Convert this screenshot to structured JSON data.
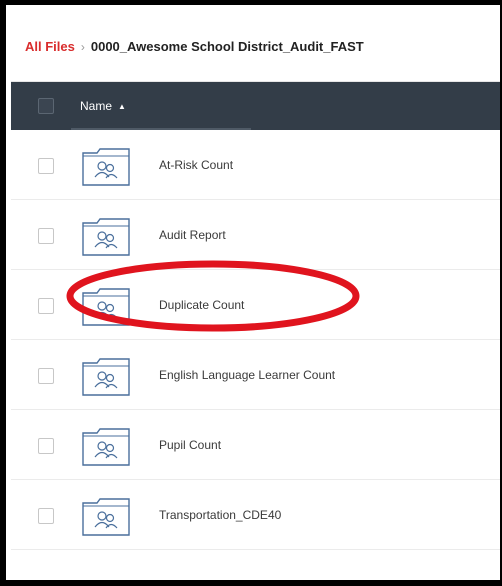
{
  "breadcrumb": {
    "root": "All Files",
    "separator": "›",
    "current": "0000_Awesome School District_Audit_FAST"
  },
  "table": {
    "header": {
      "name_label": "Name",
      "sort_indicator": "▲"
    },
    "rows": [
      {
        "label": "At-Risk Count"
      },
      {
        "label": "Audit Report"
      },
      {
        "label": "Duplicate Count"
      },
      {
        "label": "English Language Learner Count"
      },
      {
        "label": "Pupil Count"
      },
      {
        "label": "Transportation_CDE40"
      }
    ]
  },
  "annotation": {
    "highlight_color": "#e0141e",
    "highlighted_row": "Duplicate Count"
  },
  "colors": {
    "header_bg": "#333d48",
    "breadcrumb_root": "#d92d2d",
    "folder_stroke": "#4a6f9c"
  },
  "icons": {
    "folder": "shared-folder-icon",
    "sort": "sort-ascending-icon"
  }
}
